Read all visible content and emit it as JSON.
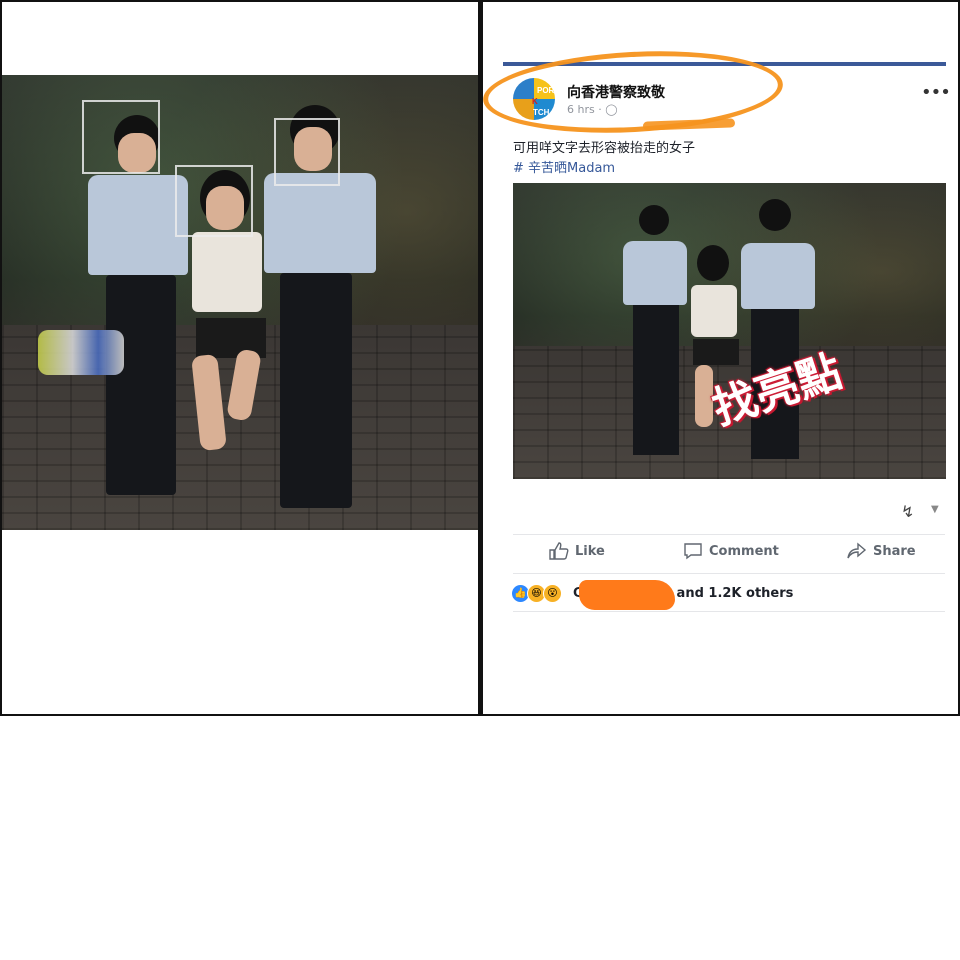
{
  "post": {
    "page_name": "向香港警察致敬",
    "meta": "6 hrs · ",
    "text": "可用咩文字去形容被抬走的女子",
    "hashtag": "# 辛苦晒Madam",
    "image_overlay_text": "找亮點",
    "avatar_letters": [
      "POR",
      "K",
      "TCH"
    ]
  },
  "actions": {
    "like": "Like",
    "comment": "Comment",
    "share": "Share"
  },
  "reactions": {
    "prefix": "C",
    "suffix": "and 1.2K others"
  },
  "colors": {
    "facebook_blue": "#3b5998",
    "annotation_orange": "#f6941e",
    "redaction_orange": "#ff7a1a",
    "overlay_red": "#d0203a"
  },
  "icons": [
    "like-icon",
    "comment-icon",
    "share-icon",
    "more-options-icon",
    "globe-icon",
    "reaction-select-icon"
  ]
}
